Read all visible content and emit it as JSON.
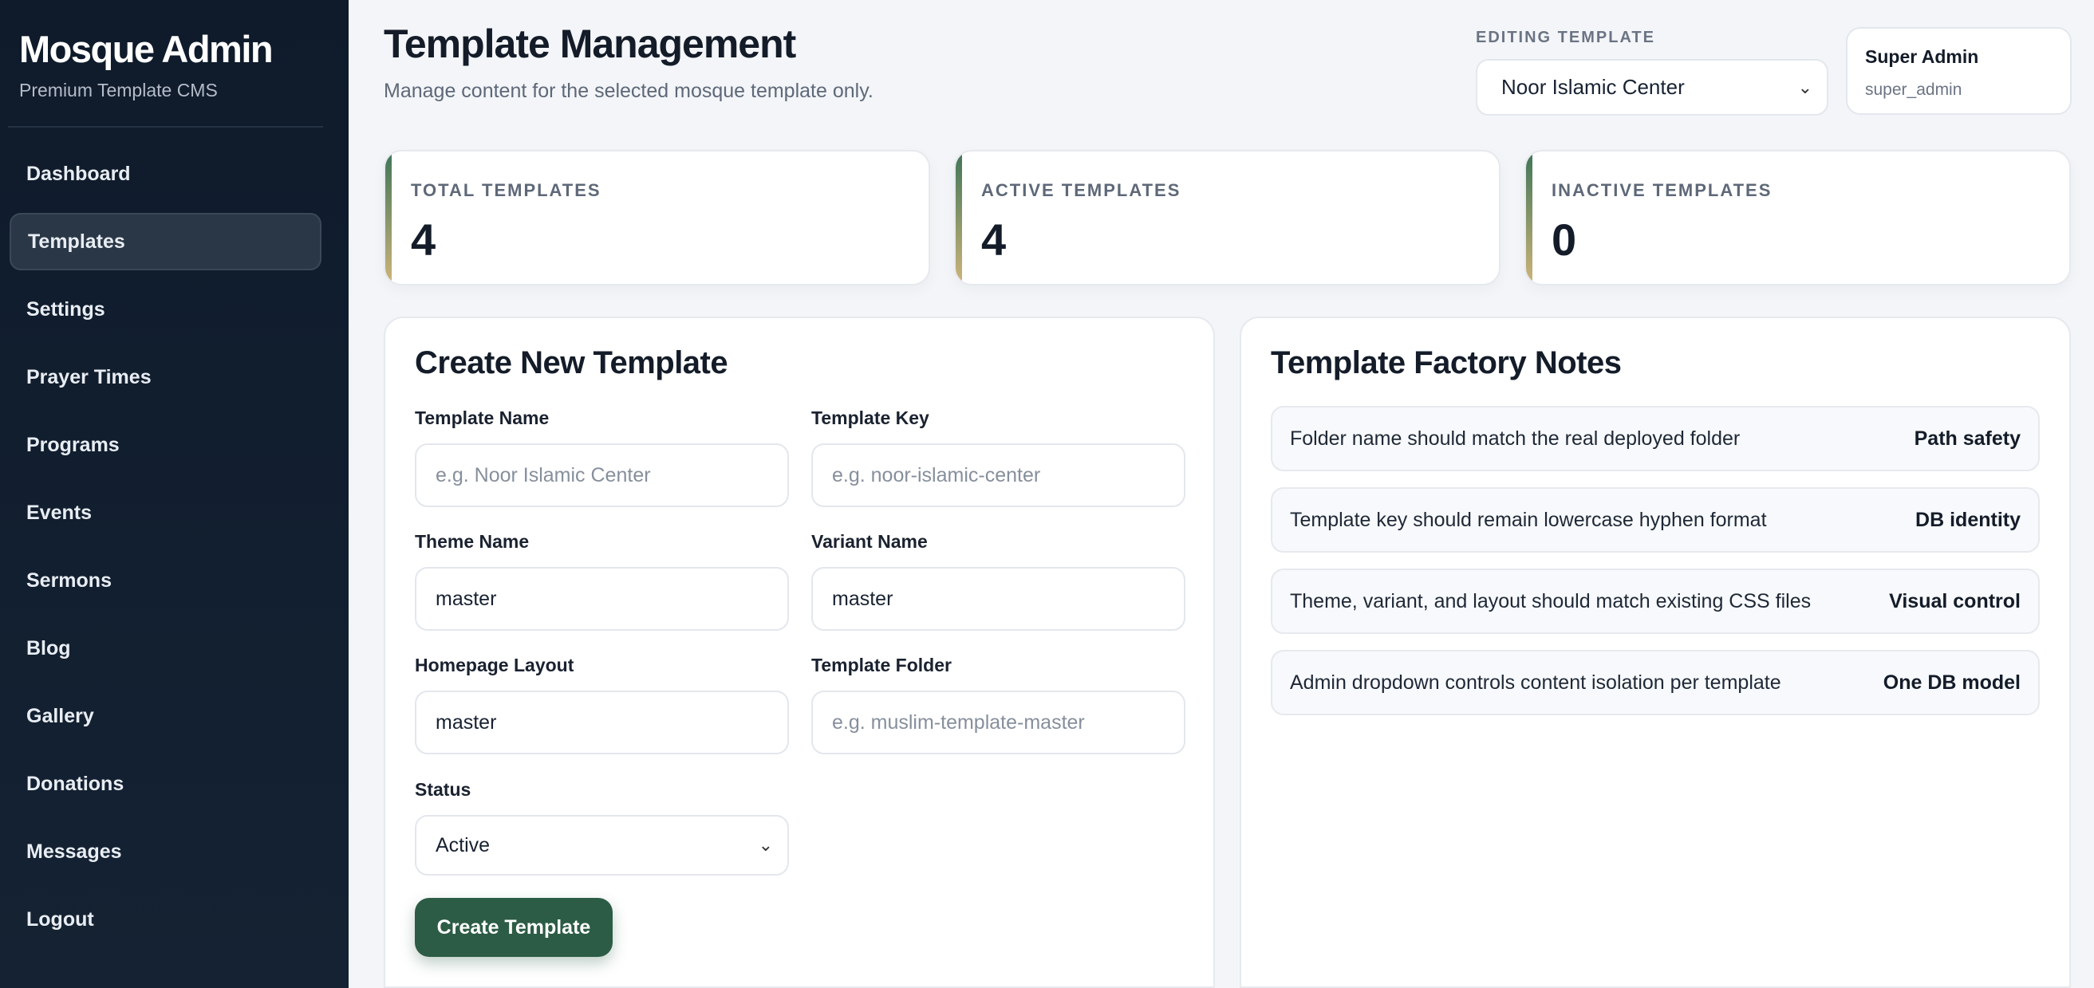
{
  "sidebar": {
    "brand_title": "Mosque Admin",
    "brand_subtitle": "Premium Template CMS",
    "items": [
      {
        "label": "Dashboard",
        "active": false
      },
      {
        "label": "Templates",
        "active": true
      },
      {
        "label": "Settings",
        "active": false
      },
      {
        "label": "Prayer Times",
        "active": false
      },
      {
        "label": "Programs",
        "active": false
      },
      {
        "label": "Events",
        "active": false
      },
      {
        "label": "Sermons",
        "active": false
      },
      {
        "label": "Blog",
        "active": false
      },
      {
        "label": "Gallery",
        "active": false
      },
      {
        "label": "Donations",
        "active": false
      },
      {
        "label": "Messages",
        "active": false
      },
      {
        "label": "Logout",
        "active": false
      }
    ]
  },
  "header": {
    "title": "Template Management",
    "subtitle": "Manage content for the selected mosque template only.",
    "editing_label": "EDITING TEMPLATE",
    "selected_template": "Noor Islamic Center",
    "user_name": "Super Admin",
    "user_handle": "super_admin"
  },
  "stats": [
    {
      "label": "TOTAL TEMPLATES",
      "value": "4"
    },
    {
      "label": "ACTIVE TEMPLATES",
      "value": "4"
    },
    {
      "label": "INACTIVE TEMPLATES",
      "value": "0"
    }
  ],
  "form": {
    "title": "Create New Template",
    "template_name_label": "Template Name",
    "template_name_placeholder": "e.g. Noor Islamic Center",
    "template_key_label": "Template Key",
    "template_key_placeholder": "e.g. noor-islamic-center",
    "theme_name_label": "Theme Name",
    "theme_name_value": "master",
    "variant_name_label": "Variant Name",
    "variant_name_value": "master",
    "homepage_layout_label": "Homepage Layout",
    "homepage_layout_value": "master",
    "template_folder_label": "Template Folder",
    "template_folder_placeholder": "e.g. muslim-template-master",
    "status_label": "Status",
    "status_value": "Active",
    "submit_label": "Create Template"
  },
  "notes": {
    "title": "Template Factory Notes",
    "items": [
      {
        "text": "Folder name should match the real deployed folder",
        "tag": "Path safety"
      },
      {
        "text": "Template key should remain lowercase hyphen format",
        "tag": "DB identity"
      },
      {
        "text": "Theme, variant, and layout should match existing CSS files",
        "tag": "Visual control"
      },
      {
        "text": "Admin dropdown controls content isolation per template",
        "tag": "One DB model"
      }
    ]
  },
  "colors": {
    "sidebar_bg": "#0f1b2b",
    "accent_green": "#2c5c45",
    "accent_gold": "#cdb47a"
  }
}
